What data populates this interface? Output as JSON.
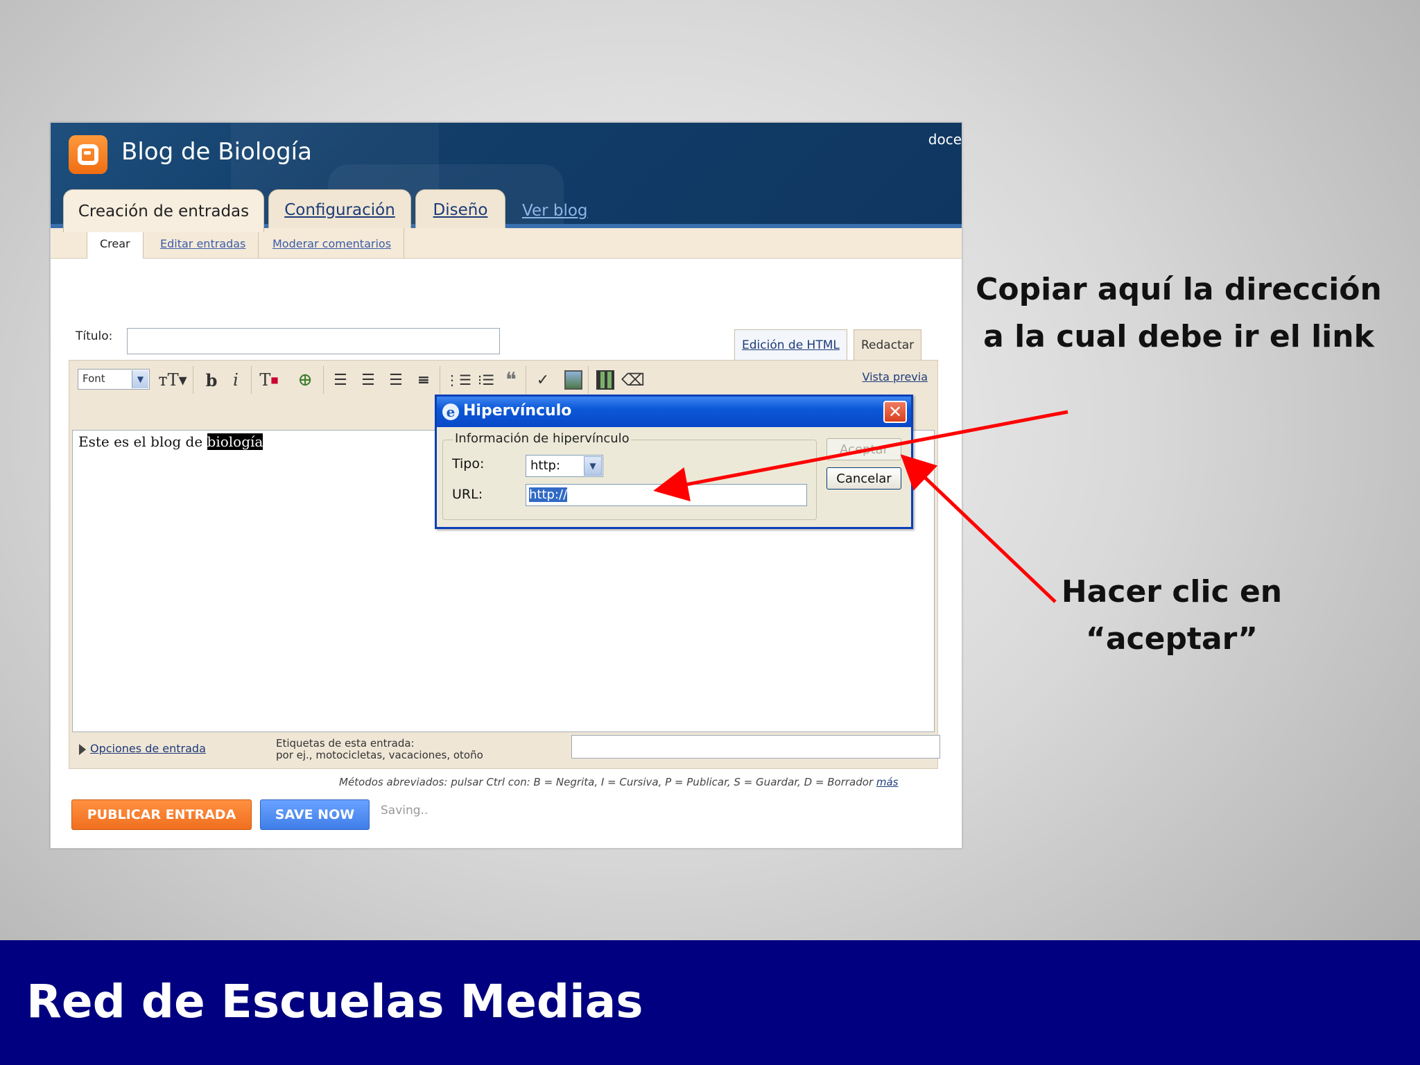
{
  "blog": {
    "title": "Blog de Biología",
    "user_fragment": "doce"
  },
  "main_tabs": {
    "creacion": "Creación de entradas",
    "configuracion": "Configuración",
    "diseno": "Diseño",
    "ver_blog": "Ver blog"
  },
  "sub_tabs": {
    "crear": "Crear",
    "editar": "Editar entradas",
    "moderar": "Moderar comentarios"
  },
  "post": {
    "titulo_label": "Título:",
    "titulo_value": "",
    "mode_html": "Edición de HTML",
    "mode_redactar": "Redactar",
    "font_select": "Font",
    "vista_previa": "Vista previa",
    "body_text_before": "Este es el blog de ",
    "body_text_selected": "biología",
    "opciones": "Opciones de entrada",
    "etiquetas_label_1": "Etiquetas de esta entrada:",
    "etiquetas_label_2": "por ej., motocicletas, vacaciones, otoño",
    "shortcuts_prefix": "Métodos abreviados: pulsar Ctrl con: B = Negrita, I = Cursiva, P = Publicar, S = Guardar, D = Borrador ",
    "shortcuts_more": "más",
    "btn_publicar": "PUBLICAR ENTRADA",
    "btn_save": "SAVE NOW",
    "saving": "Saving.."
  },
  "dialog": {
    "title": "Hipervínculo",
    "legend": "Información de hipervínculo",
    "tipo_label": "Tipo:",
    "tipo_value": "http:",
    "url_label": "URL:",
    "url_value": "http://",
    "btn_aceptar": "Aceptar",
    "btn_cancelar": "Cancelar"
  },
  "annotations": {
    "copiar_line1": "Copiar aquí la dirección",
    "copiar_line2": "a la cual debe ir el link",
    "hacer_line1": "Hacer clic en",
    "hacer_line2": "“aceptar”",
    "arrow_color": "#ff0000"
  },
  "footer": {
    "title": "Red de Escuelas Medias",
    "bg_color": "#000080"
  }
}
